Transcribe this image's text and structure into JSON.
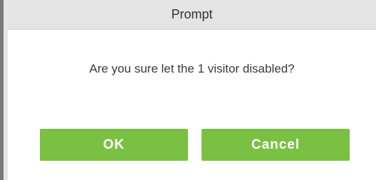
{
  "dialog": {
    "title": "Prompt",
    "message": "Are you sure let the 1 visitor disabled?",
    "ok_label": "OK",
    "cancel_label": "Cancel"
  },
  "colors": {
    "button": "#7ac143",
    "title_bar": "#e4e4e4",
    "text": "#333333"
  }
}
